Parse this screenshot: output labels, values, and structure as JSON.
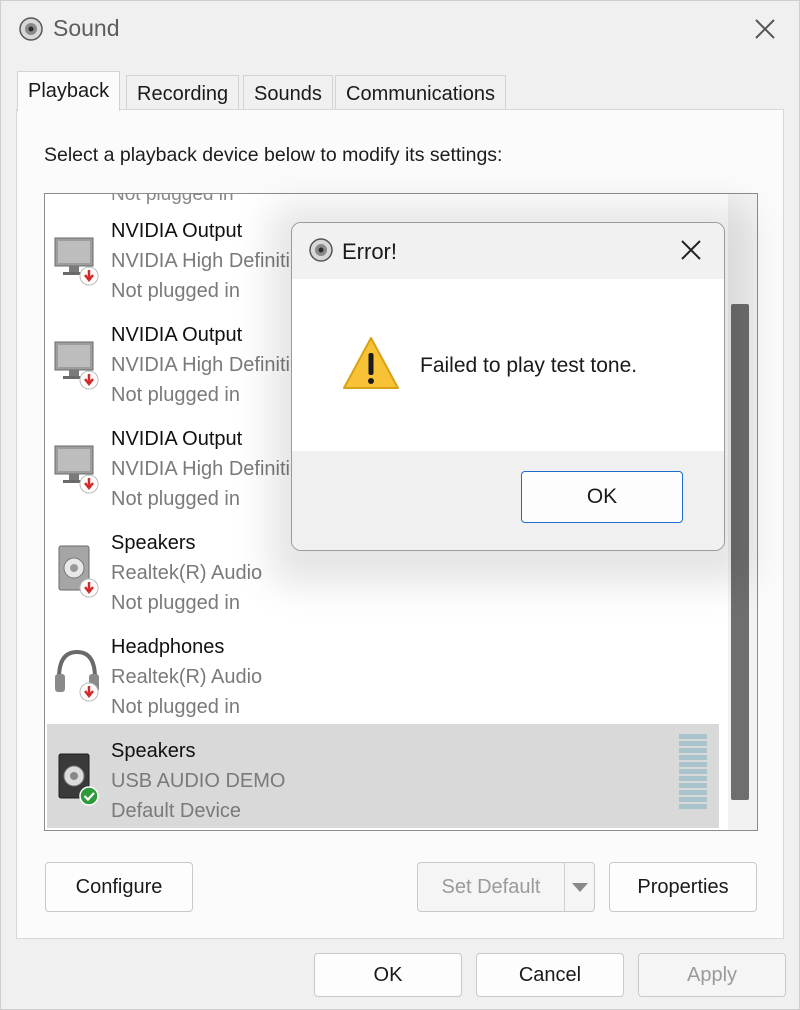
{
  "window": {
    "title": "Sound"
  },
  "tabs": [
    {
      "label": "Playback"
    },
    {
      "label": "Recording"
    },
    {
      "label": "Sounds"
    },
    {
      "label": "Communications"
    }
  ],
  "playback": {
    "instruction": "Select a playback device below to modify its settings:",
    "partial_item": "Not plugged in",
    "devices": [
      {
        "name": "NVIDIA Output",
        "driver": "NVIDIA High Definition Audio",
        "status": "Not plugged in",
        "icon": "monitor-unplugged-icon"
      },
      {
        "name": "NVIDIA Output",
        "driver": "NVIDIA High Definition Audio",
        "status": "Not plugged in",
        "icon": "monitor-unplugged-icon"
      },
      {
        "name": "NVIDIA Output",
        "driver": "NVIDIA High Definition Audio",
        "status": "Not plugged in",
        "icon": "monitor-unplugged-icon"
      },
      {
        "name": "Speakers",
        "driver": "Realtek(R) Audio",
        "status": "Not plugged in",
        "icon": "speaker-unplugged-icon"
      },
      {
        "name": "Headphones",
        "driver": "Realtek(R) Audio",
        "status": "Not plugged in",
        "icon": "headphones-unplugged-icon"
      },
      {
        "name": "Speakers",
        "driver": "USB AUDIO DEMO",
        "status": "Default Device",
        "icon": "speaker-default-icon",
        "selected": true
      }
    ]
  },
  "buttons": {
    "configure": "Configure",
    "set_default": "Set Default",
    "properties": "Properties",
    "ok": "OK",
    "cancel": "Cancel",
    "apply": "Apply"
  },
  "error_dialog": {
    "title": "Error!",
    "message": "Failed to play test tone.",
    "ok": "OK"
  },
  "colors": {
    "unplugged_badge": "#d42a2a",
    "default_badge": "#2e9b3a",
    "dialog_ok_border": "#1e6ccf",
    "level_meter": "#a9c4cc"
  }
}
